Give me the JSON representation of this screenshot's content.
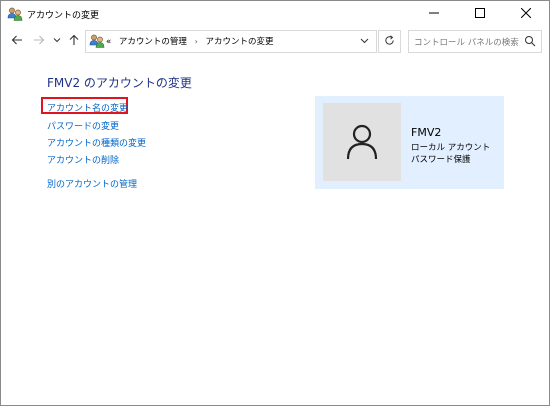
{
  "window": {
    "title": "アカウントの変更",
    "icon": "user-accounts-icon",
    "controls": [
      "minimize-icon",
      "maximize-icon",
      "close-icon"
    ]
  },
  "navbar": {
    "back_icon": "arrow-left-icon",
    "forward_icon": "arrow-right-icon",
    "recent_icon": "chevron-down-icon",
    "up_icon": "arrow-up-icon",
    "address": {
      "overflow": "«",
      "crumbs": [
        "アカウントの管理",
        "アカウントの変更"
      ],
      "separator": "›"
    },
    "refresh_icon": "refresh-icon",
    "search": {
      "placeholder": "コントロール パネルの検索",
      "icon": "search-icon"
    }
  },
  "main": {
    "heading": "FMV2 のアカウントの変更",
    "links": [
      "アカウント名の変更",
      "パスワードの変更",
      "アカウントの種類の変更",
      "アカウントの削除",
      "別のアカウントの管理"
    ],
    "highlighted_link": "アカウント名の変更",
    "highlight_color": "#e0141e",
    "link_color": "#0066cc",
    "heading_color": "#1e3287"
  },
  "account": {
    "name": "FMV2",
    "type": "ローカル アカウント",
    "protection": "パスワード保護",
    "avatar_icon": "user-silhouette-icon",
    "tile_color": "#e1efff"
  }
}
